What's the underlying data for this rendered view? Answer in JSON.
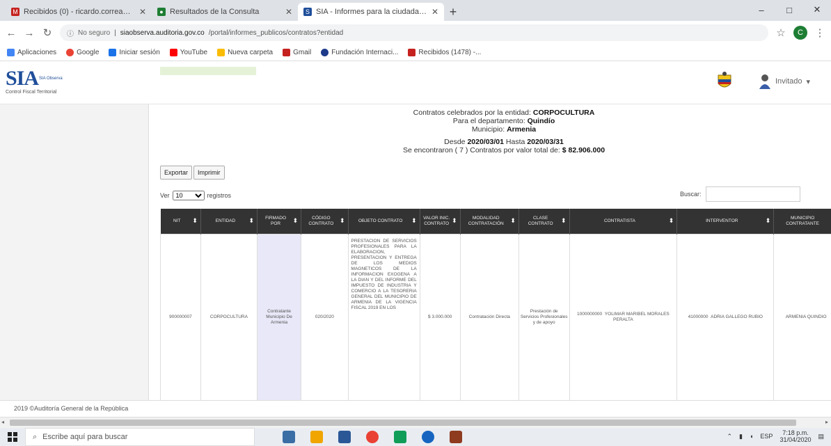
{
  "browser": {
    "tabs": [
      {
        "label": "Recibidos (0) - ricardo.correa@gm...",
        "color": "#c5221f"
      },
      {
        "label": "Resultados de la Consulta",
        "color": "#1e7e34"
      },
      {
        "label": "SIA - Informes para la ciudadanía",
        "color": "#1f4e9a"
      }
    ],
    "new_tab": "+",
    "window_controls": [
      "–",
      "□",
      "✕"
    ],
    "url_prefix": "No seguro",
    "url_host": "siaobserva.auditoria.gov.co",
    "url_path": "/portal/informes_publicos/contratos?entidad",
    "profile_initial": "C"
  },
  "bookmarks": [
    {
      "label": "Aplicaciones",
      "color": "#4285f4"
    },
    {
      "label": "Google",
      "color": "#ea4335"
    },
    {
      "label": "Iniciar sesión",
      "color": "#1a73e8"
    },
    {
      "label": "YouTube",
      "color": "#ff0000"
    },
    {
      "label": "Nueva carpeta",
      "color": "#fbbc04"
    },
    {
      "label": "Gmail",
      "color": "#c5221f"
    },
    {
      "label": "Fundación Internaci...",
      "color": "#1e3a8a"
    },
    {
      "label": "Recibidos (1478) -...",
      "color": "#c5221f"
    }
  ],
  "app": {
    "logo_text": "SIA",
    "logo_sub": "Control Fiscal Territorial",
    "logo_mini": "SIA Observa",
    "user": "Invitado"
  },
  "summary": {
    "line1_prefix": "Contratos celebrados por la entidad:",
    "entity": "CORPOCULTURA",
    "line2_prefix": "Para el departamento:",
    "department": "Quindío",
    "line3_prefix": "Municipio:",
    "municipality": "Armenia",
    "line4_prefix": "Desde",
    "date_from": "2020/03/01",
    "line4_mid": "Hasta",
    "date_to": "2020/03/31",
    "line5_prefix": "Se encontraron ( 7 ) Contratos por valor total de:",
    "total": "$ 82.906.000"
  },
  "controls": {
    "export_btn": "Exportar",
    "print_btn": "Imprimir",
    "show_label": "Ver",
    "page_len": "10",
    "records_label": "registros",
    "search_label": "Buscar:"
  },
  "table": {
    "headers": [
      "NIT",
      "ENTIDAD",
      "FIRMADO POR",
      "CÓDIGO CONTRATO",
      "OBJETO CONTRATO",
      "VALOR INIC. CONTRATO",
      "MODALIDAD CONTRATACIÓN",
      "CLASE CONTRATO",
      "CONTRATISTA",
      "INTERVENTOR",
      "MUNICIPIO CONTRATANTE"
    ],
    "row": {
      "nit": "900000007",
      "entity": "CORPOCULTURA",
      "signed_by": "Contratante Municipio De Armenia",
      "code": "020/2020",
      "object": "PRESTACION DE SERVICIOS PROFESIONALES PARA LA ELABORACION, PRESENTACION Y ENTREGA DE LOS MEDIOS MAGNETICOS DE LA INFORMACION EXOGENA A LA DIAN Y DEL INFORME DEL IMPUESTO DE INDUSTRIA Y COMERCIO A LA TESORERIA GENERAL DEL MUNICIPIO DE ARMENIA DE LA VIGENCIA FISCAL 2019 EN LOS",
      "value": "$ 3.000.000",
      "modality": "Contratación Directa",
      "class": "Prestación de Servicios Profesionales y de apoyo",
      "contractor_id": "1000000000",
      "contractor_name": "YOLIMAR MARIBEL MORALES PERALTA",
      "interventor_id": "41000000",
      "interventor_name": "ADRIA GALLEGO RUBIO",
      "municipality": "ARMENIA QUINDIO"
    }
  },
  "footer": "2019 ©Auditoría General de la República",
  "taskbar": {
    "search": "Escribe aquí para buscar",
    "lang": "ESP",
    "time": "7:18 p.m.",
    "date": "31/04/2020",
    "apps": [
      "#3a6ea5",
      "#f0a500",
      "#2b5797",
      "#e94235",
      "#0f9d58",
      "#1565c0",
      "#8e3b1f"
    ]
  }
}
